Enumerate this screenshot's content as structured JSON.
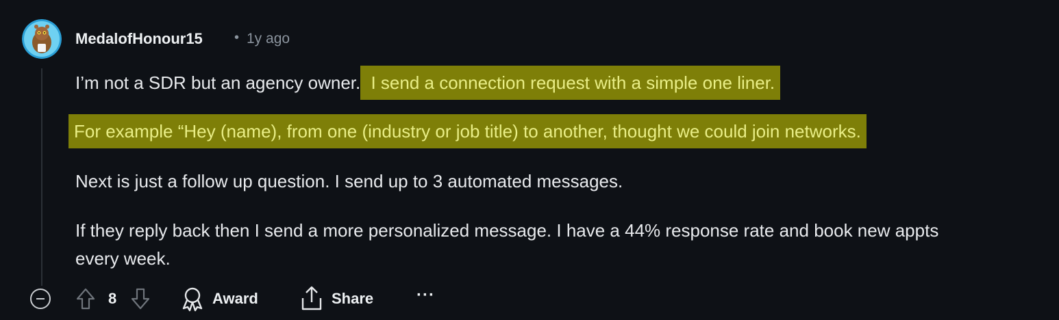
{
  "comment": {
    "username": "MedalofHonour15",
    "separator": "•",
    "timestamp": "1y ago",
    "paragraphs": {
      "p1_plain": "I’m not a SDR but an agency owner.",
      "p1_highlight": " I send a connection request with a simple one liner. ",
      "p2_highlight": " For example “Hey (name), from one (industry or job title) to another, thought we could join networks. ",
      "p3": "Next is just a follow up question. I send up to 3 automated messages.",
      "p4_line1": "If they reply back then I send a more personalized message. I have a 44% response rate and book new appts",
      "p4_line2": "every week."
    }
  },
  "actions": {
    "vote_count": "8",
    "award_label": "Award",
    "share_label": "Share",
    "more_label": "···"
  },
  "colors": {
    "background": "#0e1116",
    "highlight_bg": "#7e7f08",
    "highlight_text": "#e9ee86"
  }
}
